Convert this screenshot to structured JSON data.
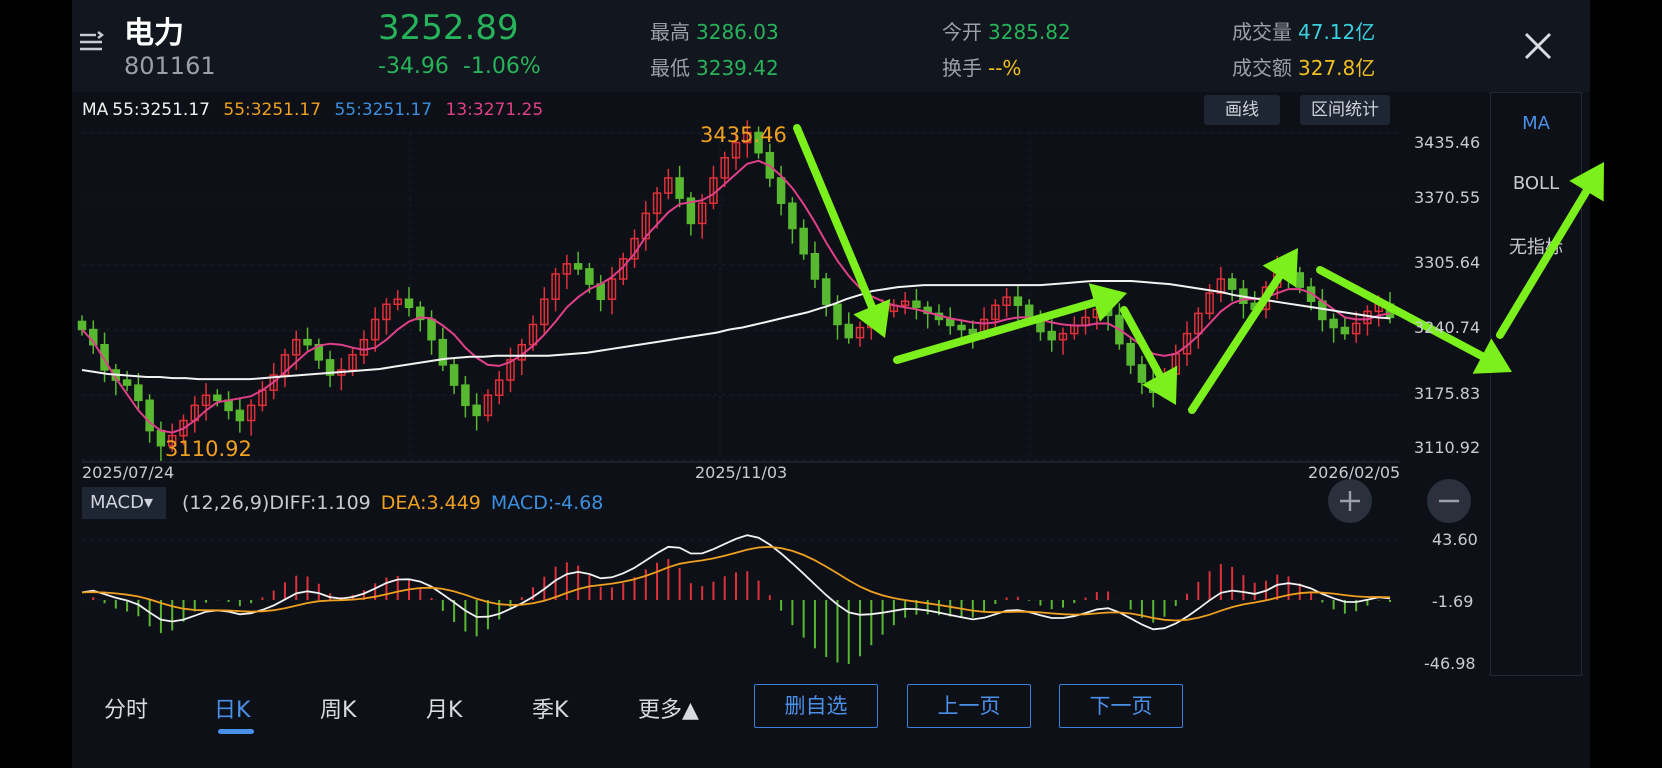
{
  "header": {
    "name": "电力",
    "code": "801161",
    "price": "3252.89",
    "change": "-34.96",
    "change_pct": "-1.06%",
    "high_label": "最高",
    "high_value": "3286.03",
    "low_label": "最低",
    "low_value": "3239.42",
    "open_label": "今开",
    "open_value": "3285.82",
    "turnover_label": "换手",
    "turnover_value": "--%",
    "volume_label": "成交量",
    "volume_value": "47.12亿",
    "amount_label": "成交额",
    "amount_value": "327.8亿"
  },
  "ma_legend": {
    "ma_label": "MA",
    "l1": "55:3251.17",
    "l2": "55:3251.17",
    "l3": "55:3251.17",
    "l4": "13:3271.25"
  },
  "tools": {
    "draw": "画线",
    "range": "区间统计"
  },
  "side_panel": {
    "items": [
      "MA",
      "BOLL",
      "无指标"
    ],
    "active": "MA"
  },
  "price_axis": [
    "3435.46",
    "3370.55",
    "3305.64",
    "3240.74",
    "3175.83",
    "3110.92"
  ],
  "high_marker": "3435.46",
  "low_marker": "3110.92",
  "dates": [
    "2025/07/24",
    "2025/11/03",
    "2026/02/05"
  ],
  "macd": {
    "selector": "MACD▾",
    "params": "(12,26,9)",
    "diff": "DIFF:1.109",
    "dea": "DEA:3.449",
    "macd": "MACD:-4.68",
    "axis": [
      "43.60",
      "-1.69",
      "-46.98"
    ]
  },
  "tabs": [
    "分时",
    "日K",
    "周K",
    "月K",
    "季K",
    "更多▲"
  ],
  "active_tab": "日K",
  "buttons": {
    "remove_watch": "删自选",
    "prev": "上一页",
    "next": "下一页"
  },
  "colors": {
    "up": "#e0303a",
    "down": "#58b830",
    "ma_short": "#e0408a",
    "ma_long": "#f2f2f2",
    "dea": "#f0a020",
    "annotation_arrow": "#7cf01c"
  },
  "chart_data": {
    "type": "candlestick",
    "candles_close": [
      3240,
      3225,
      3200,
      3190,
      3185,
      3170,
      3140,
      3125,
      3135,
      3150,
      3165,
      3175,
      3170,
      3160,
      3150,
      3165,
      3180,
      3195,
      3215,
      3230,
      3225,
      3210,
      3195,
      3200,
      3215,
      3230,
      3250,
      3265,
      3270,
      3262,
      3250,
      3230,
      3205,
      3185,
      3165,
      3155,
      3175,
      3190,
      3210,
      3225,
      3245,
      3270,
      3295,
      3305,
      3300,
      3285,
      3270,
      3290,
      3310,
      3330,
      3355,
      3375,
      3390,
      3370,
      3345,
      3365,
      3390,
      3410,
      3425,
      3435,
      3415,
      3390,
      3365,
      3340,
      3315,
      3290,
      3265,
      3245,
      3232,
      3242,
      3252,
      3258,
      3264,
      3268,
      3262,
      3256,
      3250,
      3244,
      3240,
      3236,
      3250,
      3264,
      3272,
      3264,
      3250,
      3238,
      3230,
      3236,
      3244,
      3252,
      3260,
      3254,
      3226,
      3205,
      3188,
      3178,
      3196,
      3216,
      3236,
      3256,
      3276,
      3290,
      3280,
      3266,
      3260,
      3282,
      3304,
      3296,
      3282,
      3268,
      3250,
      3242,
      3236,
      3246,
      3258,
      3265,
      3252
    ],
    "ma_short": [
      3240,
      3228,
      3210,
      3192,
      3176,
      3160,
      3148,
      3140,
      3138,
      3142,
      3150,
      3160,
      3168,
      3170,
      3172,
      3174,
      3180,
      3188,
      3198,
      3208,
      3218,
      3224,
      3226,
      3225,
      3222,
      3220,
      3222,
      3230,
      3240,
      3248,
      3252,
      3251,
      3244,
      3235,
      3222,
      3212,
      3205,
      3204,
      3208,
      3215,
      3224,
      3235,
      3248,
      3262,
      3272,
      3280,
      3285,
      3292,
      3302,
      3315,
      3332,
      3344,
      3356,
      3364,
      3366,
      3368,
      3374,
      3384,
      3394,
      3404,
      3407,
      3402,
      3392,
      3380,
      3364,
      3346,
      3326,
      3308,
      3293,
      3281,
      3273,
      3268,
      3264,
      3262,
      3260,
      3257,
      3254,
      3251,
      3249,
      3247,
      3246,
      3247,
      3250,
      3252,
      3252,
      3250,
      3247,
      3245,
      3244,
      3244,
      3246,
      3246,
      3240,
      3232,
      3224,
      3216,
      3214,
      3216,
      3224,
      3234,
      3246,
      3258,
      3266,
      3270,
      3270,
      3272,
      3276,
      3280,
      3280,
      3276,
      3268,
      3260,
      3252,
      3250,
      3250,
      3254,
      3256
    ],
    "ma_long": [
      3200,
      3198,
      3196,
      3195,
      3194,
      3193,
      3193,
      3192,
      3192,
      3191,
      3191,
      3191,
      3191,
      3191,
      3192,
      3193,
      3194,
      3195,
      3196,
      3197,
      3198,
      3199,
      3200,
      3201,
      3203,
      3205,
      3207,
      3209,
      3211,
      3212,
      3213,
      3213,
      3214,
      3214,
      3214,
      3214,
      3214,
      3215,
      3216,
      3217,
      3219,
      3221,
      3223,
      3225,
      3227,
      3229,
      3231,
      3233,
      3235,
      3237,
      3240,
      3242,
      3245,
      3248,
      3251,
      3254,
      3257,
      3261,
      3265,
      3270,
      3274,
      3278,
      3280,
      3282,
      3283,
      3284,
      3284,
      3284,
      3284,
      3284,
      3284,
      3284,
      3284,
      3284,
      3284,
      3285,
      3286,
      3287,
      3288,
      3288,
      3288,
      3288,
      3287,
      3286,
      3285,
      3283,
      3281,
      3279,
      3277,
      3274,
      3272,
      3270,
      3268,
      3266,
      3264,
      3262,
      3260,
      3258,
      3256,
      3254,
      3252,
      3251
    ]
  }
}
